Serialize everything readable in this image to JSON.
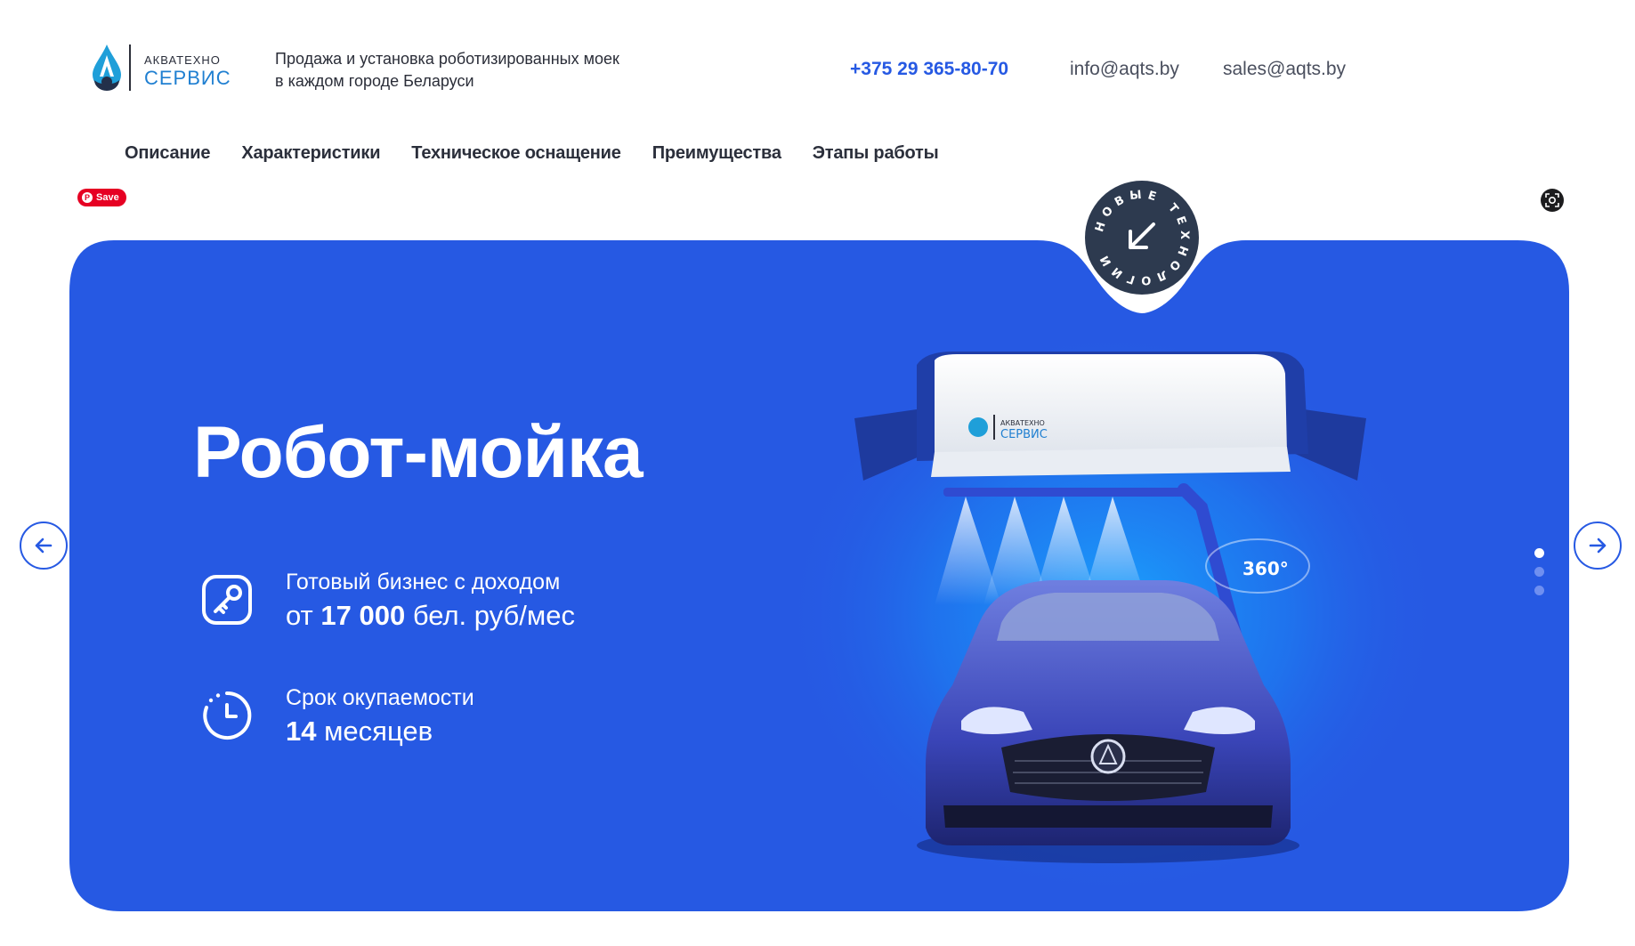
{
  "brand": {
    "logo_top": "АКВАТЕХНО",
    "logo_bottom": "СЕРВИС",
    "tagline_line1": "Продажа и установка роботизированных моек",
    "tagline_line2": "в каждом городе Беларуси"
  },
  "contacts": {
    "phone": "+375 29 365-80-70",
    "email_info": "info@aqts.by",
    "email_sales": "sales@aqts.by"
  },
  "nav": {
    "items": [
      {
        "label": "Описание"
      },
      {
        "label": "Характеристики"
      },
      {
        "label": "Техническое оснащение"
      },
      {
        "label": "Преимущества"
      },
      {
        "label": "Этапы работы"
      }
    ]
  },
  "overlay": {
    "pinterest_save": "Save"
  },
  "badge": {
    "text": "НОВЫЕ ТЕХНОЛОГИИ"
  },
  "hero": {
    "title": "Робот-мойка",
    "feature1_line1": "Готовый бизнес с доходом",
    "feature1_prefix": "от",
    "feature1_value": "17 000",
    "feature1_suffix": "бел. руб/мес",
    "feature2_line1": "Срок окупаемости",
    "feature2_value": "14",
    "feature2_suffix": "месяцев",
    "robot_logo_top": "АКВАТЕХНО",
    "robot_logo_bottom": "СЕРВИС",
    "rotation_label": "360°"
  },
  "slider": {
    "slide_count": 3,
    "active_slide": 1
  },
  "colors": {
    "hero_blue": "#2659e3",
    "badge_dark": "#2d3a4f",
    "brand_light_blue": "#1f7fd1"
  },
  "icons": {
    "badge_arrow": "arrow-down-left-icon",
    "feature1": "key-icon",
    "feature2": "clock-icon",
    "prev": "arrow-left-icon",
    "next": "arrow-right-icon"
  }
}
